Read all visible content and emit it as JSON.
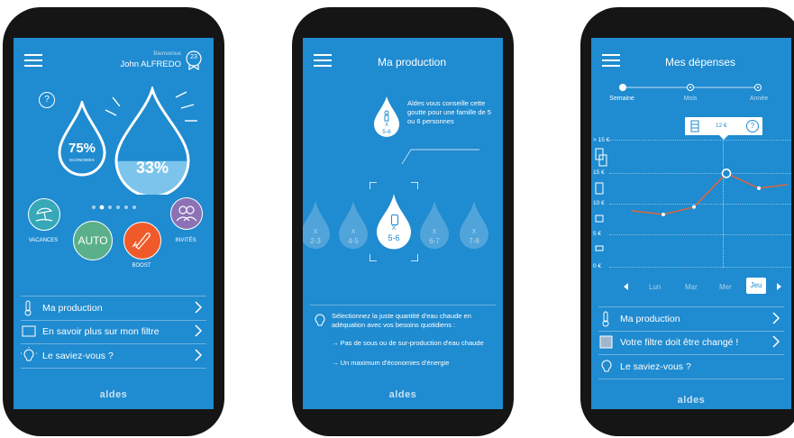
{
  "colors": {
    "screen_bg": "#1f8bd0",
    "accent_orange": "#f05a2a",
    "accent_green": "#5bb08a",
    "accent_teal": "#36a8b8",
    "accent_purple": "#8c71b5",
    "line_orange": "#e0643a"
  },
  "screen1": {
    "welcome": "Bienvenue",
    "user_name": "John ALFREDO",
    "badge": "23",
    "help": "?",
    "savings_pct": "75%",
    "savings_label": "ECONOMIES",
    "level_pct": "33%",
    "level_fraction": 0.33,
    "vacation_label": "VACANCES",
    "auto_label": "AUTO",
    "boost_label": "BOOST",
    "guests_label": "INVITÉS",
    "menu": [
      {
        "label": "Ma production",
        "icon": "thermometer-icon"
      },
      {
        "label": "En savoir plus sur mon filtre",
        "icon": "filter-icon"
      },
      {
        "label": "Le saviez-vous ?",
        "icon": "bulb-icon"
      }
    ],
    "brand": "aldes"
  },
  "screen2": {
    "title": "Ma production",
    "advice": "Aldes vous conseille cette goutte pour une famille de 5 ou 6 personnes",
    "advice_drop_x": "X",
    "advice_drop_range": "5-6",
    "drops": [
      {
        "x": "X",
        "range": "2-3"
      },
      {
        "x": "X",
        "range": "4-5"
      },
      {
        "x": "X",
        "range": "5-6"
      },
      {
        "x": "X",
        "range": "6-7"
      },
      {
        "x": "X",
        "range": "7-8"
      }
    ],
    "info_main": "Sélectionnez la juste quantité d'eau chaude en adéquation avec vos besoins quotidiens :",
    "bullet1": "→ Pas de sous ou de sur-production d'eau chaude",
    "bullet2": "→ Un maximum d'économies d'énergie",
    "brand": "aldes"
  },
  "screen3": {
    "title": "Mes dépenses",
    "periods": [
      "Semaine",
      "Mois",
      "Année"
    ],
    "tooltip_value": "12 €",
    "tooltip_help": "?",
    "y_labels": [
      "> 15 €",
      "15 €",
      "10 €",
      "5 €",
      "0 €"
    ],
    "days": [
      "Lun",
      "Mar",
      "Mer",
      "Jeu"
    ],
    "selected_day": "Jeu",
    "chart_data": {
      "type": "line",
      "x": [
        "",
        "Lun",
        "Mar",
        "Mer",
        "Jeu",
        ""
      ],
      "values": [
        7.5,
        7,
        8,
        12.5,
        10.5,
        11
      ],
      "ylim": [
        0,
        17
      ],
      "highlight_index": 3
    },
    "menu": [
      {
        "label": "Ma production",
        "icon": "thermometer-icon"
      },
      {
        "label": "Votre filtre doit être changé !",
        "icon": "filter-icon"
      },
      {
        "label": "Le saviez-vous ?",
        "icon": "bulb-icon"
      }
    ],
    "brand": "aldes"
  }
}
